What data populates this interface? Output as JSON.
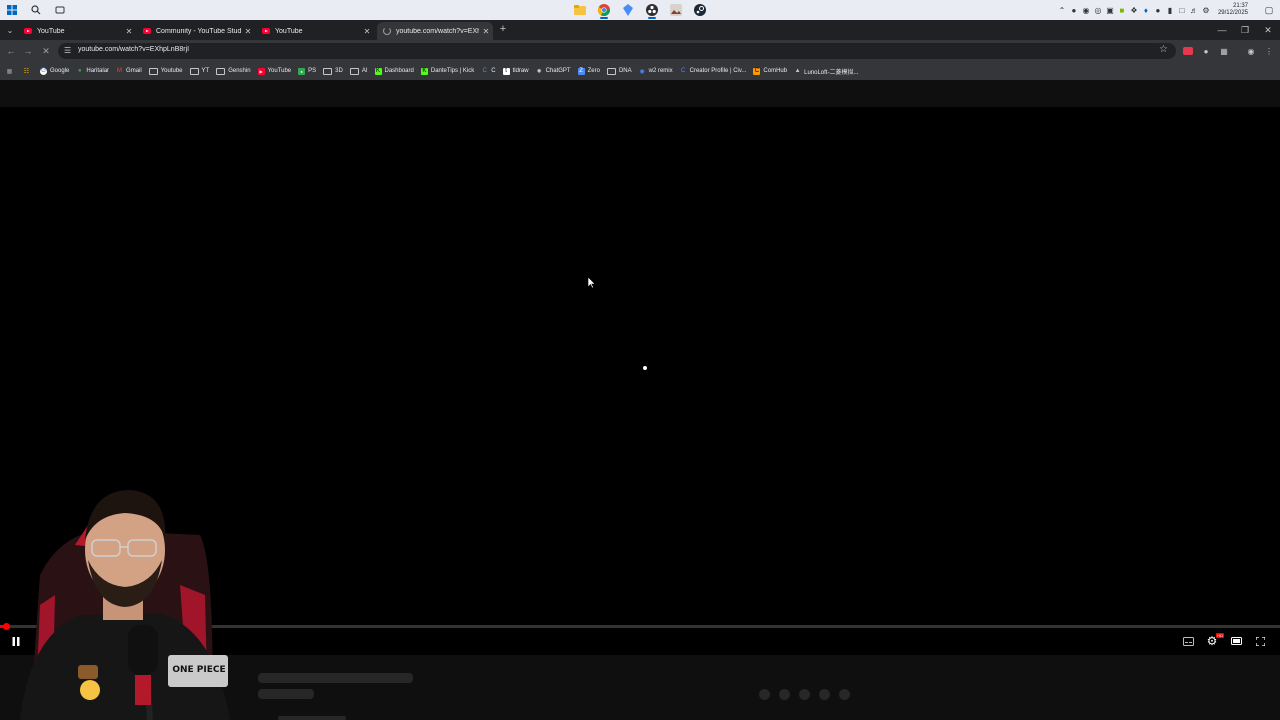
{
  "taskbar": {
    "time": "21:37",
    "date": "29/12/2025"
  },
  "tabs": [
    {
      "title": "YouTube"
    },
    {
      "title": "Community - YouTube Studio"
    },
    {
      "title": "YouTube"
    },
    {
      "title": "youtube.com/watch?v=EXhpLnB..."
    }
  ],
  "address_bar": {
    "url": "youtube.com/watch?v=EXhpLnB8rjI"
  },
  "bookmarks": [
    "Google",
    "Haritalar",
    "Gmail",
    "Youtube",
    "YT",
    "Genshin",
    "YouTube",
    "PS",
    "3D",
    "AI",
    "Dashboard",
    "DanteTips | Kick",
    "C",
    "tldraw",
    "ChatGPT",
    "Zero",
    "DNA",
    "w2 remix",
    "Creator Profile | Civ...",
    "ComHub",
    "LunoLoft-二菱模拟..."
  ],
  "player": {
    "progress_percent": 0.5,
    "state": "playing"
  },
  "webcam": {
    "shirt_text": "ONE PIECE"
  }
}
